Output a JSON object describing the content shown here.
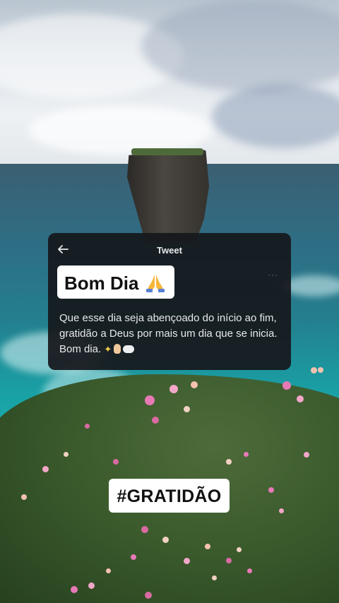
{
  "tweet": {
    "header_title": "Tweet",
    "body": "Que esse dia seja abençoado do início ao fim, gratidão a Deus por mais um dia que se inicia. Bom dia.",
    "more": "···",
    "back_symbol": "←"
  },
  "stickers": {
    "greeting": "Bom Dia",
    "hashtag": "#GRATIDÃO"
  },
  "icons": {
    "back": "arrow-left-icon",
    "pray": "praying-hands-icon",
    "sparkles": "sparkles-icon",
    "hand": "crossed-fingers-icon",
    "bubble": "thought-bubble-icon",
    "more": "more-options-icon"
  },
  "colors": {
    "tweet_card_bg": "#15181c",
    "sticker_bg": "#ffffff",
    "sticker_text": "#111111"
  }
}
